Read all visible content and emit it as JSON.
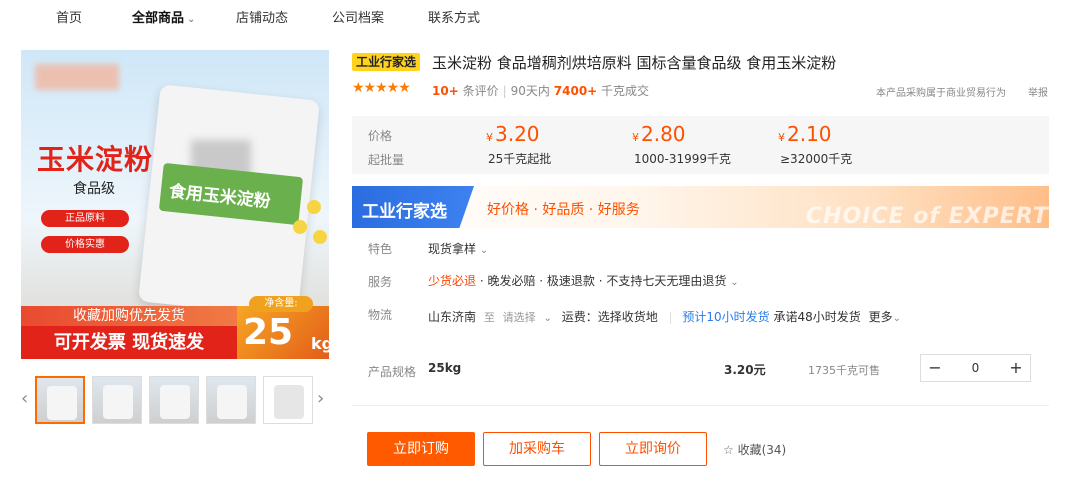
{
  "nav": {
    "items": [
      "首页",
      "全部商品",
      "店铺动态",
      "公司档案",
      "联系方式"
    ],
    "active_index": 1
  },
  "gallery": {
    "main_title": "玉米淀粉",
    "main_subtitle": "食品级",
    "pills": [
      "正品原料",
      "价格实惠"
    ],
    "bag_text": "食用玉米淀粉",
    "banner_top": "收藏加购优先发货",
    "banner_bottom": "可开发票  现货速发",
    "net_label": "净含量:",
    "net_value": "25",
    "net_unit": "kg",
    "thumbnail_count": 5,
    "active_thumbnail": 0
  },
  "product": {
    "badge": "工业行家选",
    "title": "玉米淀粉 食品增稠剂烘培原料 国标含量食品级 食用玉米淀粉",
    "stars": "★★★★★",
    "review_count": "10+",
    "review_label": "条评价",
    "deal_prefix": "90天内",
    "deal_count": "7400+",
    "deal_suffix": "千克成交",
    "trade_note": "本产品采购属于商业贸易行为",
    "report": "举报"
  },
  "pricing": {
    "price_label": "价格",
    "moq_label": "起批量",
    "currency": "¥",
    "tiers": [
      {
        "price": "3.20",
        "range": "25千克起批"
      },
      {
        "price": "2.80",
        "range": "1000-31999千克"
      },
      {
        "price": "2.10",
        "range": "≥32000千克"
      }
    ]
  },
  "expert": {
    "tag": "工业行家选",
    "slogan": "好价格 · 好品质 · 好服务",
    "watermark": "CHOICE of EXPERT"
  },
  "attributes": {
    "feature_label": "特色",
    "feature_value": "现货拿样",
    "service_label": "服务",
    "service_red": "少货必退",
    "service_rest": " · 晚发必赔 · 极速退款 · 不支持七天无理由退货",
    "logistics_label": "物流",
    "origin": "山东济南",
    "to": "至",
    "destination": "请选择",
    "freight": "运费：选择收货地",
    "eta": "预计10小时发货",
    "promise": "承诺48小时发货",
    "more": "更多"
  },
  "spec": {
    "label": "产品规格",
    "value": "25kg",
    "price": "3.20元",
    "stock": "1735千克可售",
    "quantity": "0"
  },
  "actions": {
    "buy": "立即订购",
    "cart": "加采购车",
    "inquiry": "立即询价",
    "favorite": "收藏(34)"
  },
  "colors": {
    "accent": "#ff5000",
    "badge_yellow": "#ffd21e",
    "expert_blue": "#2b6de0"
  }
}
